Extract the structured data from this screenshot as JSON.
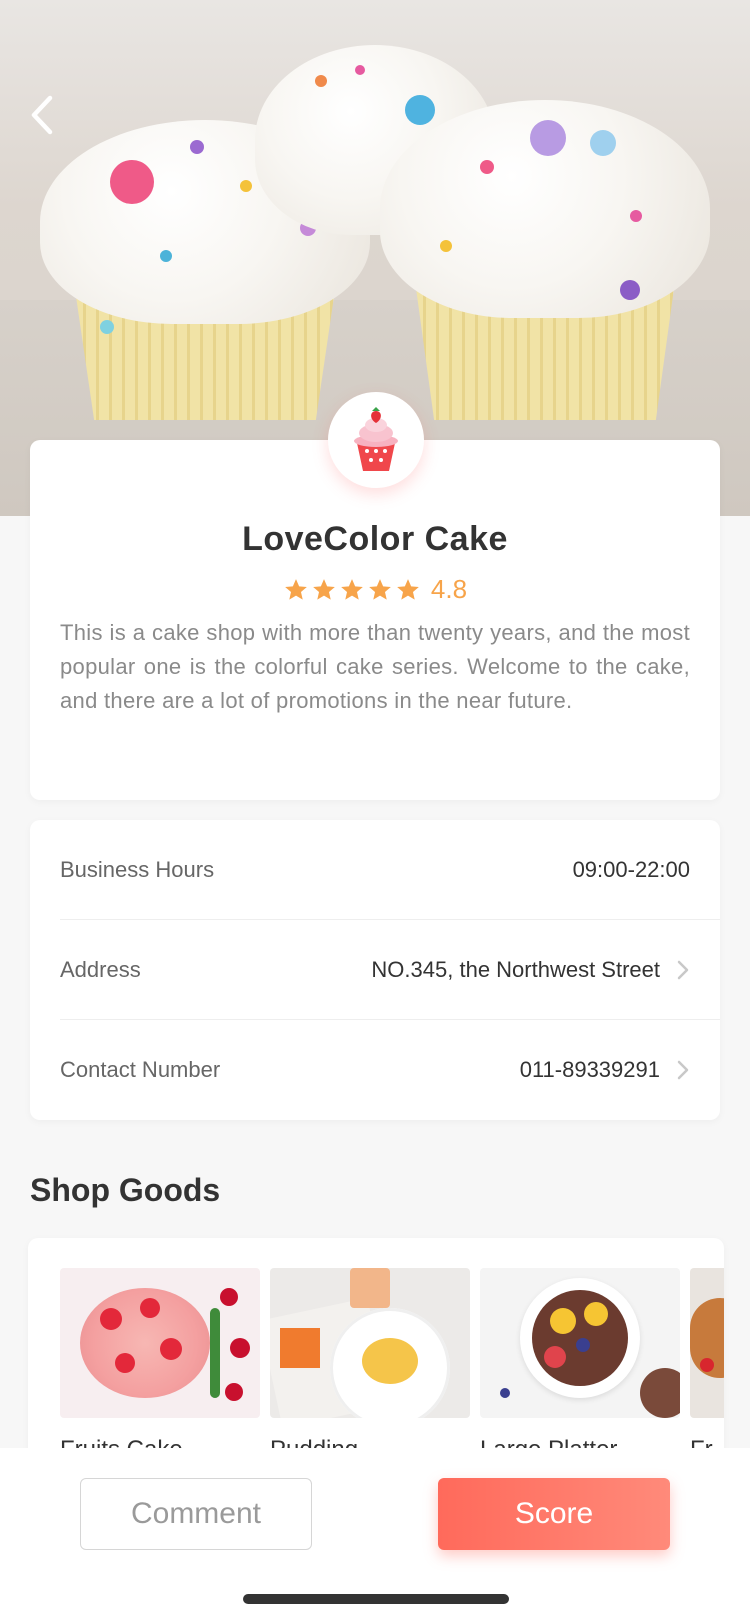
{
  "header": {
    "back_icon": "chevron-left-icon"
  },
  "shop": {
    "name": "LoveColor Cake",
    "rating": "4.8",
    "stars": 5,
    "logo_icon": "cupcake-icon",
    "description": "This is a cake shop with more than twenty years, and the most popular one is the colorful cake series. Welcome to the cake, and there are a lot of promotions in the near future."
  },
  "info": {
    "hours_label": "Business Hours",
    "hours_value": "09:00-22:00",
    "address_label": "Address",
    "address_value": "NO.345, the Northwest Street",
    "contact_label": "Contact Number",
    "contact_value": "011-89339291"
  },
  "goods": {
    "title": "Shop Goods",
    "items": [
      {
        "name": "Fruits Cake"
      },
      {
        "name": "Pudding"
      },
      {
        "name": "Large Platter"
      },
      {
        "name": "Fr"
      }
    ]
  },
  "actions": {
    "comment_label": "Comment",
    "score_label": "Score"
  },
  "colors": {
    "accent": "#ff6a5b",
    "star": "#f7a44a"
  }
}
